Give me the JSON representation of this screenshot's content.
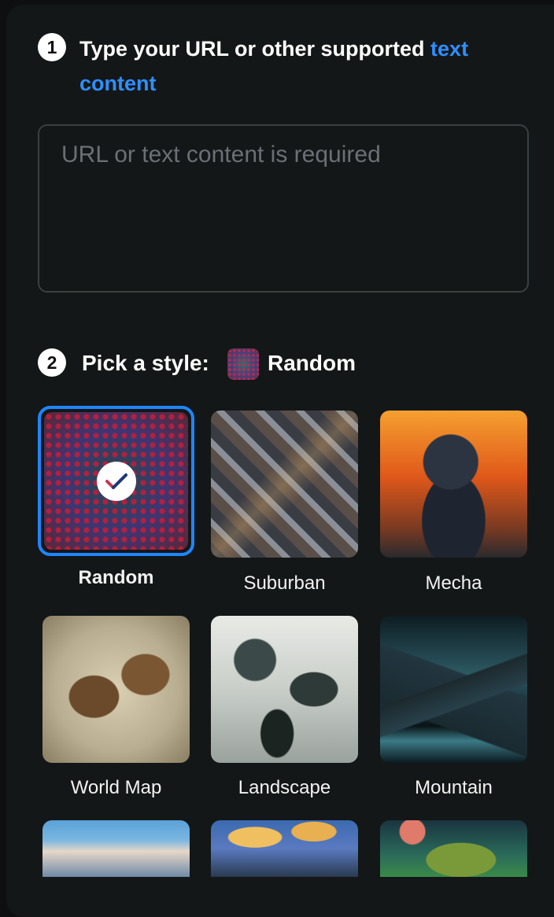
{
  "step1": {
    "number": "1",
    "text": "Type your URL or other supported",
    "link": "text content"
  },
  "url_input": {
    "placeholder": "URL or text content is required",
    "value": ""
  },
  "step2": {
    "number": "2",
    "label": "Pick a style:",
    "selected_style": "Random"
  },
  "styles": [
    {
      "label": "Random",
      "selected": true
    },
    {
      "label": "Suburban"
    },
    {
      "label": "Mecha"
    },
    {
      "label": "World Map"
    },
    {
      "label": "Landscape"
    },
    {
      "label": "Mountain"
    }
  ],
  "colors": {
    "accent": "#2e8fff",
    "selected_border": "#1e86ff",
    "panel_bg": "#141718"
  }
}
